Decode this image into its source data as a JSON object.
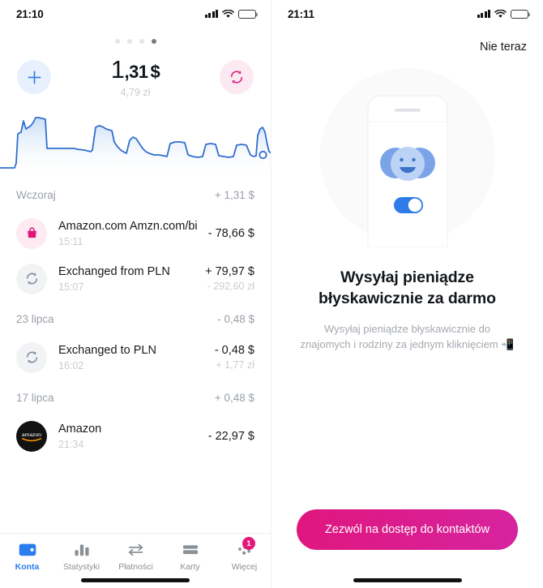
{
  "left": {
    "status": {
      "time": "21:10",
      "signal_icon": "signal-bars-icon",
      "wifi_icon": "wifi-icon",
      "battery_icon": "battery-low-icon"
    },
    "pager": {
      "count": 4,
      "active_index": 3
    },
    "actions": {
      "add_icon": "plus-icon",
      "exchange_icon": "exchange-icon"
    },
    "balance": {
      "integer": "1",
      "decimal": ",31",
      "currency": "$",
      "secondary": "4,79 zł"
    },
    "chart": {
      "accent": "#2f6fd0",
      "end_dot_label": "current-value-dot"
    },
    "groups": [
      {
        "date_label": "Wczoraj",
        "total": "+ 1,31 $",
        "transactions": [
          {
            "icon": "shopping-bag-icon",
            "icon_style": "bag",
            "title": "Amazon.com Amzn.com/bi",
            "time": "15:11",
            "amount": "- 78,66 $",
            "amount_secondary": ""
          },
          {
            "icon": "exchange-icon",
            "icon_style": "exch",
            "title": "Exchanged from PLN",
            "time": "15:07",
            "amount": "+ 79,97 $",
            "amount_secondary": "- 292,60 zł"
          }
        ]
      },
      {
        "date_label": "23 lipca",
        "total": "- 0,48 $",
        "transactions": [
          {
            "icon": "exchange-icon",
            "icon_style": "exch",
            "title": "Exchanged to PLN",
            "time": "16:02",
            "amount": "- 0,48 $",
            "amount_secondary": "+ 1,77 zł"
          }
        ]
      },
      {
        "date_label": "17 lipca",
        "total": "+ 0,48 $",
        "transactions": [
          {
            "icon": "amazon-logo-icon",
            "icon_style": "amazon",
            "title": "Amazon",
            "time": "21:34",
            "amount": "- 22,97 $",
            "amount_secondary": ""
          }
        ]
      }
    ],
    "tabs": [
      {
        "label": "Konta",
        "icon": "wallet-icon",
        "active": true,
        "badge": ""
      },
      {
        "label": "Statystyki",
        "icon": "bar-chart-icon",
        "active": false,
        "badge": ""
      },
      {
        "label": "Płatności",
        "icon": "transfer-arrows-icon",
        "active": false,
        "badge": ""
      },
      {
        "label": "Karty",
        "icon": "credit-card-icon",
        "active": false,
        "badge": ""
      },
      {
        "label": "Więcej",
        "icon": "more-dots-icon",
        "active": false,
        "badge": "1"
      }
    ]
  },
  "right": {
    "status": {
      "time": "21:11",
      "signal_icon": "signal-bars-icon",
      "wifi_icon": "wifi-icon",
      "battery_icon": "battery-low-icon"
    },
    "skip_label": "Nie teraz",
    "illustration": "phone-with-friends-toggle-illustration",
    "title": "Wysyłaj pieniądze błyskawicznie za darmo",
    "subtitle": "Wysyłaj pieniądze błyskawicznie do znajomych i rodziny za jednym kliknięciem 📲",
    "cta_label": "Zezwól na dostęp do kontaktów",
    "cta_color": "#e0167e"
  },
  "chart_data": {
    "type": "area",
    "title": "",
    "xlabel": "",
    "ylabel": "",
    "grid": false,
    "x": [
      0,
      1,
      2,
      3,
      4,
      5,
      6,
      7,
      8,
      9,
      10,
      11,
      12,
      13,
      14,
      15,
      16,
      17,
      18,
      19,
      20,
      21,
      22,
      23,
      24,
      25,
      26,
      27,
      28,
      29,
      30,
      31,
      32,
      33,
      34,
      35,
      36,
      37,
      38,
      39,
      40,
      41,
      42,
      43,
      44,
      45,
      46,
      47,
      48,
      49,
      50,
      51,
      52,
      53,
      54,
      55,
      56,
      57,
      58,
      59,
      60,
      61,
      62
    ],
    "values": [
      8,
      8,
      8,
      8,
      8,
      56,
      58,
      72,
      60,
      62,
      76,
      88,
      86,
      88,
      86,
      22,
      22,
      22,
      22,
      22,
      22,
      22,
      22,
      18,
      16,
      14,
      70,
      72,
      62,
      60,
      58,
      30,
      22,
      16,
      12,
      48,
      50,
      30,
      18,
      14,
      12,
      10,
      10,
      10,
      10,
      34,
      34,
      34,
      12,
      10,
      8,
      8,
      32,
      32,
      12,
      10,
      8,
      8,
      8,
      60,
      62,
      20,
      12
    ],
    "ylim": [
      0,
      100
    ]
  }
}
